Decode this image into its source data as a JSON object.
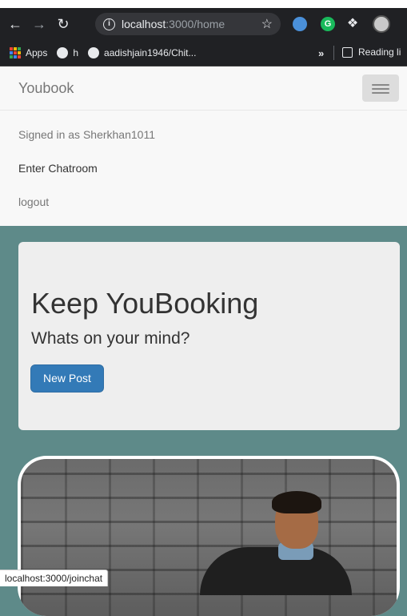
{
  "browser": {
    "url_host": "localhost",
    "url_path": ":3000/home",
    "bookmarks": [
      {
        "label": "Apps"
      },
      {
        "label": "h"
      },
      {
        "label": "aadishjain1946/Chit..."
      }
    ],
    "overflow_label": "»",
    "reading_list_label": "Reading li",
    "status_url": "localhost:3000/joinchat",
    "extension_g_label": "G"
  },
  "navbar": {
    "brand": "Youbook"
  },
  "menu": {
    "signed_in": "Signed in as Sherkhan1011",
    "chatroom": "Enter Chatroom",
    "logout": "logout"
  },
  "jumbotron": {
    "title": "Keep YouBooking",
    "subtitle": "Whats on your mind?",
    "button": "New Post"
  },
  "colors": {
    "page_bg": "#5e8a89",
    "primary_button": "#337ab7",
    "navbar_bg": "#f8f8f8"
  }
}
